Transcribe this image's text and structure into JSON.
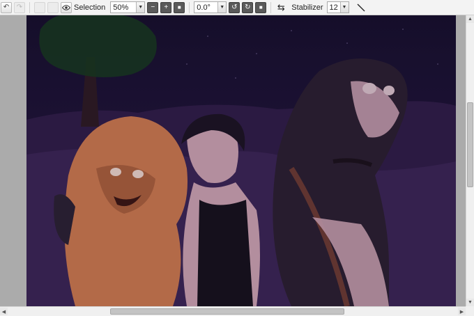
{
  "toolbar": {
    "selection_label": "Selection",
    "zoom": {
      "value": "50%"
    },
    "rotation": {
      "value": "0.0°"
    },
    "stabilizer_label": "Stabilizer",
    "stabilizer": {
      "value": "12"
    },
    "zoom_out_glyph": "−",
    "zoom_in_glyph": "+",
    "fit_glyph": "■",
    "rotate_left_glyph": "↺",
    "rotate_right_glyph": "↻",
    "rotate_reset_glyph": "■",
    "flip_glyph": "⇆",
    "undo_glyph": "↶",
    "redo_glyph": "↷",
    "dropdown_glyph": "▼"
  },
  "scrollbars": {
    "up_glyph": "▲",
    "down_glyph": "▼",
    "left_glyph": "◀",
    "right_glyph": "▶"
  },
  "colors": {
    "night_sky": "#1c1233",
    "hills": "#3a2452",
    "hills_dark": "#2b1a40",
    "orange_creature": "#c9774c",
    "dark_creature": "#2a1e2e",
    "skin": "#c9a0ae",
    "tree": "#163a1c"
  }
}
